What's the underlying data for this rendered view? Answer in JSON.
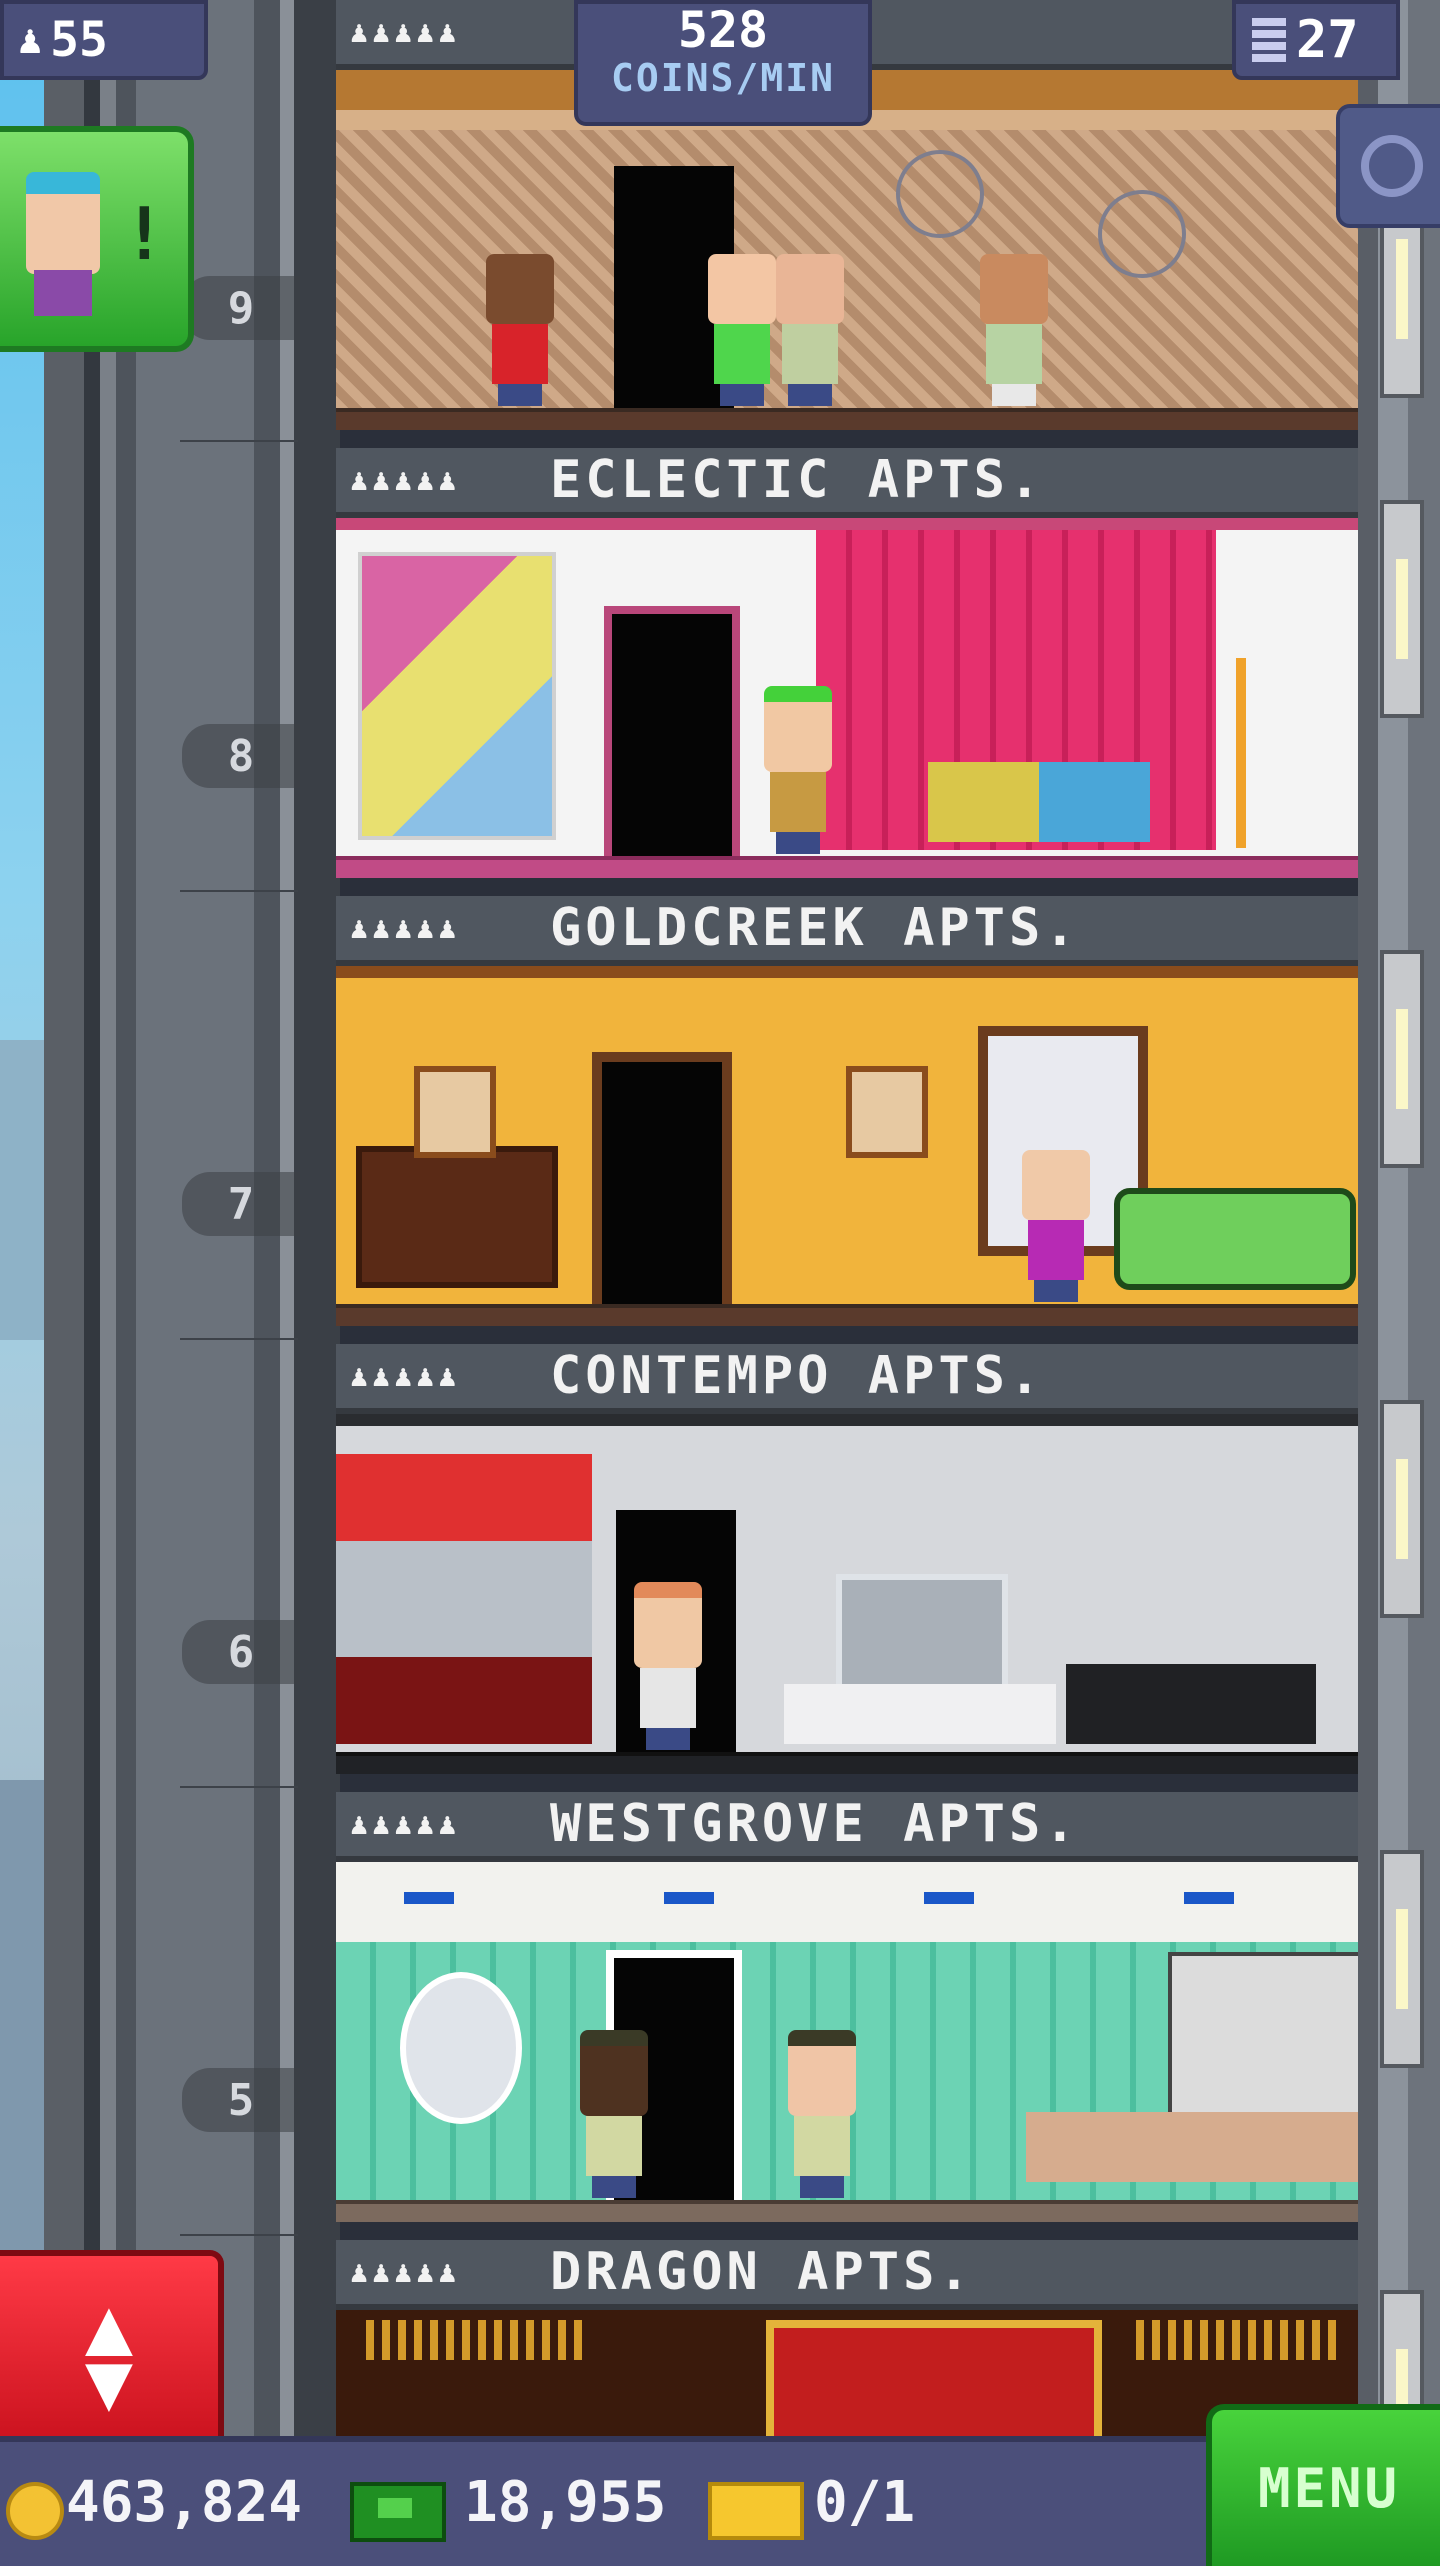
{
  "hud": {
    "population": "55",
    "coins_rate_value": "528",
    "coins_rate_unit": "COINS/MIN",
    "floor_count": "27"
  },
  "floors": [
    {
      "number": "9",
      "name": "",
      "occupancy": "♟♟♟♟♟"
    },
    {
      "number": "8",
      "name": "ECLECTIC APTS.",
      "occupancy": "♟♟♟♟♟"
    },
    {
      "number": "7",
      "name": "GOLDCREEK APTS.",
      "occupancy": "♟♟♟♟♟"
    },
    {
      "number": "6",
      "name": "CONTEMPO APTS.",
      "occupancy": "♟♟♟♟♟"
    },
    {
      "number": "5",
      "name": "WESTGROVE APTS.",
      "occupancy": "♟♟♟♟♟"
    },
    {
      "number": "",
      "name": "DRAGON APTS.",
      "occupancy": "♟♟♟♟♟"
    }
  ],
  "bottom_bar": {
    "coins": "463,824",
    "tower_bux": "18,955",
    "golden_tickets": "0/1",
    "menu_label": "MENU"
  },
  "icons": {
    "population": "person-icon",
    "floors": "building-icon",
    "zoom": "magnifier-icon",
    "coins": "coin-icon",
    "bux": "bux-icon",
    "ticket": "ticket-icon",
    "elevator": "up-down-arrows-icon"
  },
  "colors": {
    "hud_panel": "#4a4f7a",
    "menu_green": "#2fb52e",
    "elevator_red": "#e41c2a",
    "alert_green": "#4fc84a"
  }
}
